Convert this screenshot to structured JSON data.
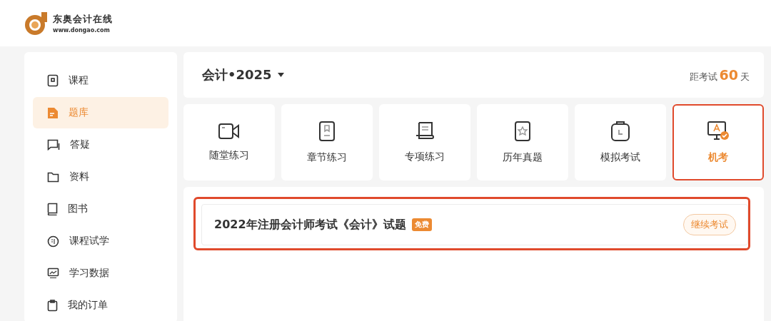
{
  "logo": {
    "name": "东奥会计在线",
    "url": "www.dongao.com"
  },
  "sidebar": {
    "items": [
      {
        "label": "课程",
        "selected": false
      },
      {
        "label": "题库",
        "selected": true
      },
      {
        "label": "答疑",
        "selected": false
      },
      {
        "label": "资料",
        "selected": false
      },
      {
        "label": "图书",
        "selected": false
      },
      {
        "label": "课程试学",
        "selected": false
      },
      {
        "label": "学习数据",
        "selected": false
      },
      {
        "label": "我的订单",
        "selected": false
      }
    ]
  },
  "subject": {
    "label": "会计•2025",
    "countdown_prefix": "距考试",
    "countdown_days": "60",
    "countdown_suffix": "天"
  },
  "tiles": [
    {
      "label": "随堂练习",
      "selected": false,
      "highlighted": false
    },
    {
      "label": "章节练习",
      "selected": false,
      "highlighted": false
    },
    {
      "label": "专项练习",
      "selected": false,
      "highlighted": false
    },
    {
      "label": "历年真题",
      "selected": false,
      "highlighted": false
    },
    {
      "label": "模拟考试",
      "selected": false,
      "highlighted": false
    },
    {
      "label": "机考",
      "selected": true,
      "highlighted": true
    }
  ],
  "exams": {
    "highlighted": true,
    "items": [
      {
        "title": "2022年注册会计师考试《会计》试题",
        "badge": "免费",
        "action": "继续考试"
      }
    ]
  }
}
